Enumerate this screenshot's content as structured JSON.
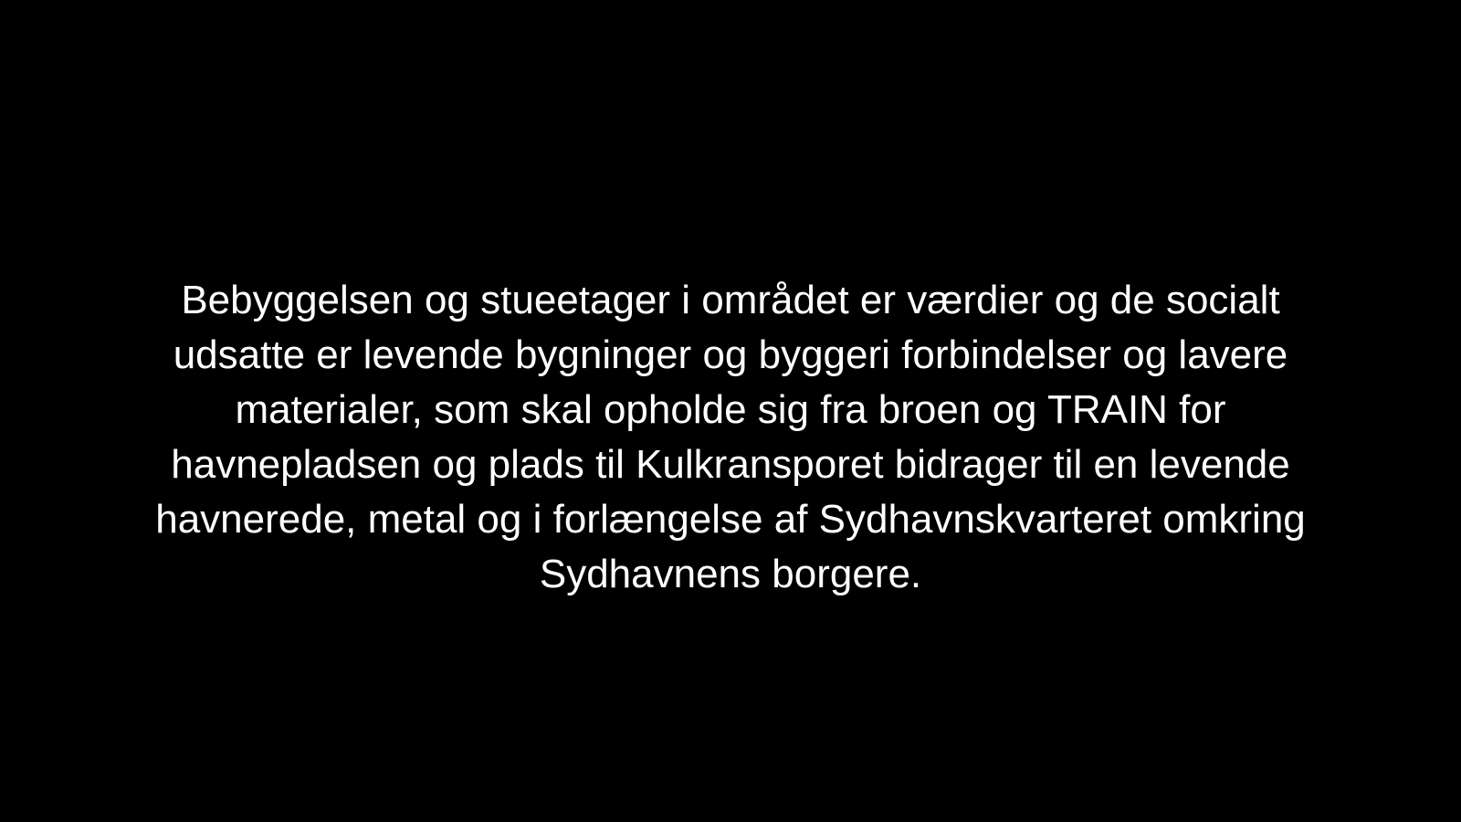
{
  "colors": {
    "background": "#000000",
    "text": "#ffffff"
  },
  "caption": {
    "lines": [
      "Bebyggelsen og stueetager i området er værdier og de socialt",
      "udsatte er levende bygninger og byggeri forbindelser og lavere",
      "materialer, som skal opholde sig fra broen og TRAIN for",
      "havnepladsen og plads til Kulkransporet bidrager til en levende",
      "havnerede, metal og i forlængelse af Sydhavnskvarteret omkring",
      "Sydhavnens borgere."
    ]
  }
}
